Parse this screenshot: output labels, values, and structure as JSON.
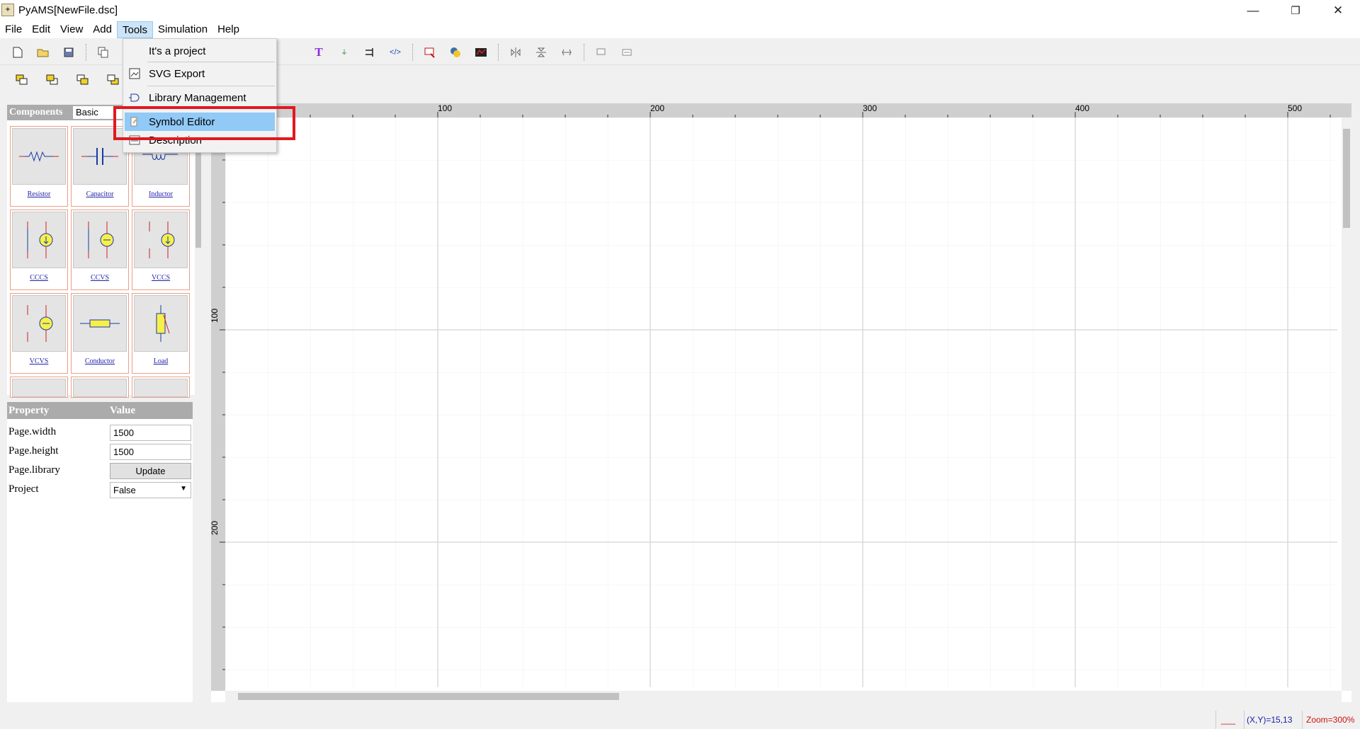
{
  "window": {
    "title": "PyAMS[NewFile.dsc]",
    "minimize": "—",
    "maximize": "❐",
    "close": "✕"
  },
  "menubar": [
    "File",
    "Edit",
    "View",
    "Add",
    "Tools",
    "Simulation",
    "Help"
  ],
  "tools_menu": {
    "items": [
      {
        "label": "It's a project",
        "icon": "blank-icon"
      },
      {
        "label": "SVG Export",
        "icon": "svg-export-icon"
      },
      {
        "label": "Library Management",
        "icon": "library-icon"
      },
      {
        "label": "Symbol Editor",
        "icon": "symbol-editor-icon",
        "highlighted": true
      },
      {
        "label": "Description",
        "icon": "description-icon"
      }
    ]
  },
  "library": {
    "header": "Components",
    "selected_library": "Basic",
    "components": [
      "Resistor",
      "Capacitor",
      "Inductor",
      "CCCS",
      "CCVS",
      "VCCS",
      "VCVS",
      "Conductor",
      "Load"
    ]
  },
  "properties": {
    "header_property": "Property",
    "header_value": "Value",
    "rows": [
      {
        "key": "Page.width",
        "value": "1500"
      },
      {
        "key": "Page.height",
        "value": "1500"
      },
      {
        "key": "Page.library",
        "value": "Update"
      },
      {
        "key": "Project",
        "value": "False"
      }
    ]
  },
  "rulers": {
    "top": [
      "100",
      "200",
      "300",
      "400",
      "500"
    ],
    "left": [
      "100",
      "200"
    ]
  },
  "status": {
    "coords": "(X,Y)=15,13",
    "zoom": "Zoom=300%",
    "indicator": "___"
  },
  "colors": {
    "highlight": "#91c9f7",
    "callout": "#e0191f",
    "coords": "#1a1aaa",
    "zoom": "#d01010"
  }
}
